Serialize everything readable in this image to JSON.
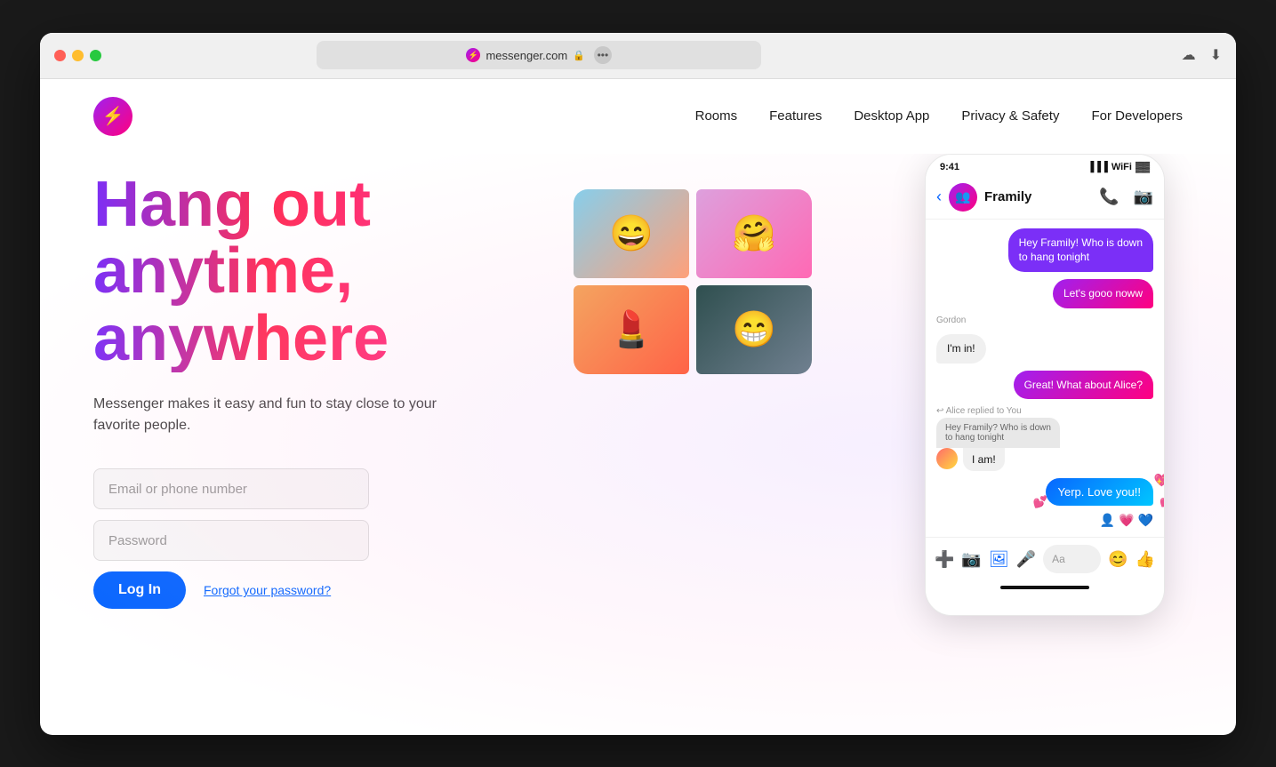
{
  "browser": {
    "url": "messenger.com",
    "favicon": "⚡",
    "more_button": "•••"
  },
  "nav": {
    "logo_char": "⚡",
    "links": [
      {
        "id": "rooms",
        "label": "Rooms"
      },
      {
        "id": "features",
        "label": "Features"
      },
      {
        "id": "desktop_app",
        "label": "Desktop App"
      },
      {
        "id": "privacy_safety",
        "label": "Privacy & Safety"
      },
      {
        "id": "developers",
        "label": "For Developers"
      }
    ]
  },
  "hero": {
    "title": "Hang out anytime, anywhere",
    "subtitle": "Messenger makes it easy and fun to stay close to your favorite people.",
    "email_placeholder": "Email or phone number",
    "password_placeholder": "Password",
    "login_button": "Log In",
    "forgot_password": "Forgot your password?"
  },
  "phone": {
    "time": "9:41",
    "chat_name": "Framily",
    "messages": [
      {
        "type": "sent",
        "text": "Hey Framily! Who is down to hang tonight"
      },
      {
        "type": "sent_gradient",
        "text": "Let's gooo noww"
      },
      {
        "type": "label",
        "label": "Gordon"
      },
      {
        "type": "received",
        "text": "I'm in!"
      },
      {
        "type": "sent_pink",
        "text": "Great! What about Alice?"
      },
      {
        "type": "reply_label",
        "label": "Alice replied to You"
      },
      {
        "type": "reply_preview",
        "preview": "Hey Framily? Who is down to hang tonight"
      },
      {
        "type": "reply_main",
        "text": "I am!"
      },
      {
        "type": "sent_blue",
        "text": "Yerp. Love you!!"
      }
    ],
    "input_placeholder": "Aa"
  }
}
